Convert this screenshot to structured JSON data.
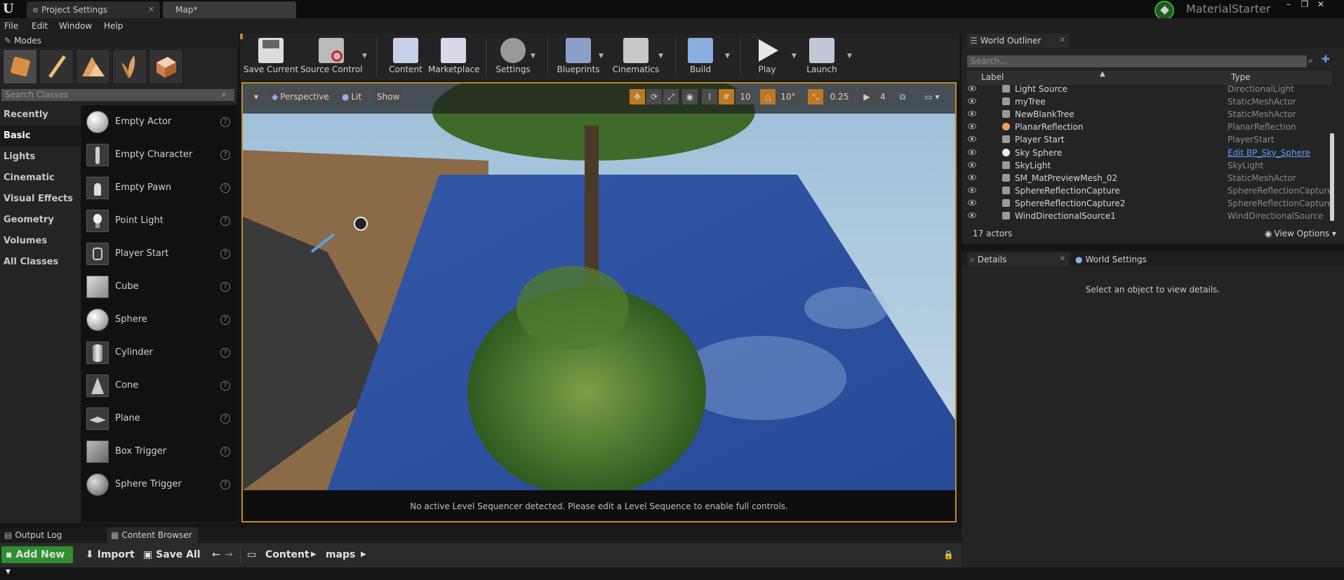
{
  "titlebar": {
    "tabs": [
      "Project Settings",
      "Map*"
    ],
    "project_name": "MaterialStarter",
    "window_controls": [
      "–",
      "❐",
      "✕"
    ]
  },
  "menu": [
    "File",
    "Edit",
    "Window",
    "Help"
  ],
  "modes": {
    "tab_label": "Modes",
    "search_placeholder": "Search Classes",
    "categories": [
      "Recently Placed",
      "Basic",
      "Lights",
      "Cinematic",
      "Visual Effects",
      "Geometry",
      "Volumes",
      "All Classes"
    ],
    "active_category": "Basic",
    "classes": [
      "Empty Actor",
      "Empty Character",
      "Empty Pawn",
      "Point Light",
      "Player Start",
      "Cube",
      "Sphere",
      "Cylinder",
      "Cone",
      "Plane",
      "Box Trigger",
      "Sphere Trigger"
    ]
  },
  "toolbar": {
    "buttons": [
      "Save Current",
      "Source Control",
      "Content",
      "Marketplace",
      "Settings",
      "Blueprints",
      "Cinematics",
      "Build",
      "Play",
      "Launch"
    ]
  },
  "viewport": {
    "view_mode": "Perspective",
    "lighting": "Lit",
    "show": "Show",
    "grid_snap": "10",
    "rotation_snap": "10°",
    "scale_snap": "0.25",
    "camera_speed": "4",
    "sequencer_message": "No active Level Sequencer detected. Please edit a Level Sequence to enable full controls."
  },
  "outliner": {
    "tab_label": "World Outliner",
    "search_placeholder": "Search...",
    "col_label": "Label",
    "col_type": "Type",
    "rows": [
      {
        "label": "Light Source",
        "type": "DirectionalLight",
        "link": false
      },
      {
        "label": "myTree",
        "type": "StaticMeshActor",
        "link": false
      },
      {
        "label": "NewBlankTree",
        "type": "StaticMeshActor",
        "link": false
      },
      {
        "label": "PlanarReflection",
        "type": "PlanarReflection",
        "link": false
      },
      {
        "label": "Player Start",
        "type": "PlayerStart",
        "link": false
      },
      {
        "label": "Sky Sphere",
        "type": "Edit BP_Sky_Sphere",
        "link": true
      },
      {
        "label": "SkyLight",
        "type": "SkyLight",
        "link": false
      },
      {
        "label": "SM_MatPreviewMesh_02",
        "type": "StaticMeshActor",
        "link": false
      },
      {
        "label": "SphereReflectionCapture",
        "type": "SphereReflectionCapture",
        "link": false
      },
      {
        "label": "SphereReflectionCapture2",
        "type": "SphereReflectionCapture",
        "link": false
      },
      {
        "label": "WindDirectionalSource1",
        "type": "WindDirectionalSource",
        "link": false
      }
    ],
    "actor_count": "17 actors",
    "view_options": "View Options"
  },
  "details": {
    "tabs": [
      "Details",
      "World Settings"
    ],
    "empty_message": "Select an object to view details."
  },
  "bottom": {
    "tabs": [
      "Output Log",
      "Content Browser"
    ],
    "add_new": "Add New",
    "import": "Import",
    "save_all": "Save All",
    "path": [
      "Content",
      "maps"
    ]
  },
  "colors": {
    "accent": "#c08a24",
    "link": "#5aa2ff",
    "add_new_green": "#2f8f2f"
  }
}
